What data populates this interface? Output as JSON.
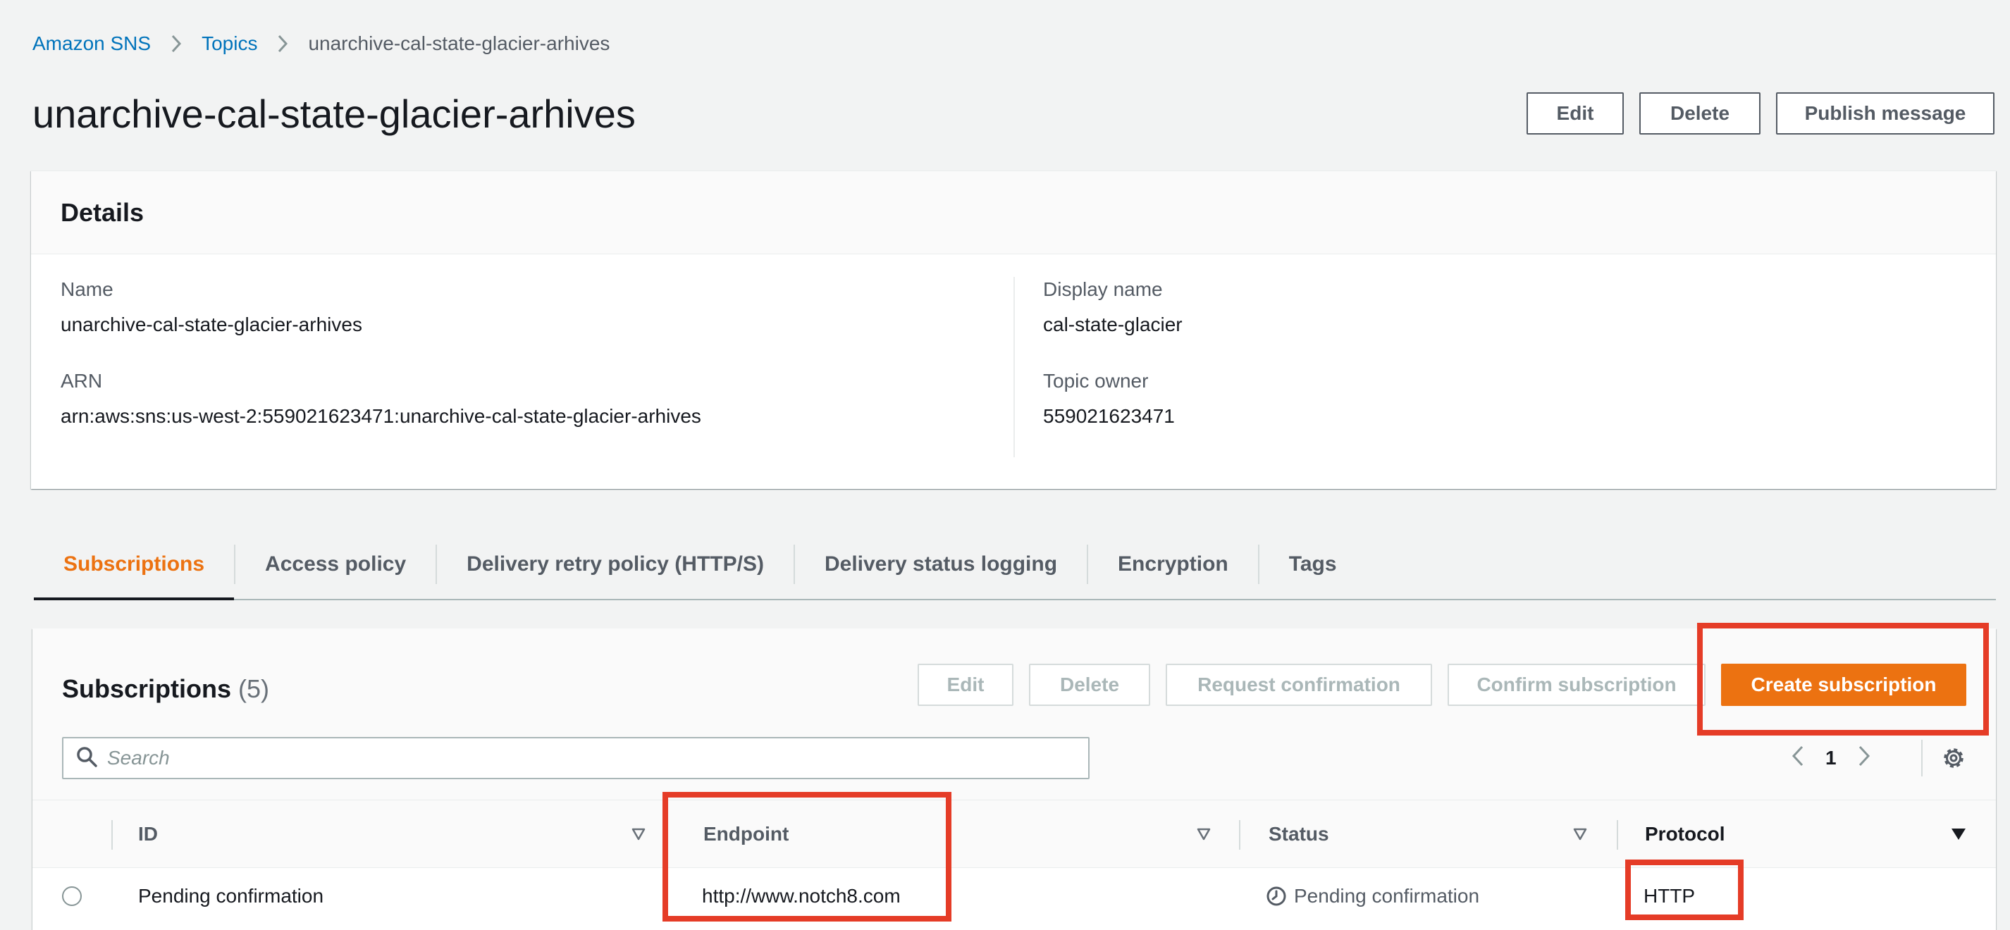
{
  "breadcrumb": {
    "root": "Amazon SNS",
    "topics": "Topics",
    "current": "unarchive-cal-state-glacier-arhives"
  },
  "page": {
    "title": "unarchive-cal-state-glacier-arhives"
  },
  "header_actions": {
    "edit": "Edit",
    "delete": "Delete",
    "publish": "Publish message"
  },
  "details": {
    "title": "Details",
    "name_label": "Name",
    "name_value": "unarchive-cal-state-glacier-arhives",
    "arn_label": "ARN",
    "arn_value": "arn:aws:sns:us-west-2:559021623471:unarchive-cal-state-glacier-arhives",
    "display_name_label": "Display name",
    "display_name_value": "cal-state-glacier",
    "owner_label": "Topic owner",
    "owner_value": "559021623471"
  },
  "tabs": [
    {
      "label": "Subscriptions",
      "active": true
    },
    {
      "label": "Access policy"
    },
    {
      "label": "Delivery retry policy (HTTP/S)"
    },
    {
      "label": "Delivery status logging"
    },
    {
      "label": "Encryption"
    },
    {
      "label": "Tags"
    }
  ],
  "subscriptions": {
    "title": "Subscriptions",
    "count": "(5)",
    "actions": {
      "edit": "Edit",
      "delete": "Delete",
      "request": "Request confirmation",
      "confirm": "Confirm subscription",
      "create": "Create subscription"
    },
    "search_placeholder": "Search",
    "page": "1",
    "columns": {
      "id": "ID",
      "endpoint": "Endpoint",
      "status": "Status",
      "protocol": "Protocol"
    },
    "rows": [
      {
        "id": "Pending confirmation",
        "endpoint": "http://www.notch8.com",
        "status": "Pending confirmation",
        "protocol": "HTTP"
      }
    ]
  },
  "colors": {
    "accent": "#ec7211",
    "link": "#0073bb",
    "highlight": "#e53c27"
  },
  "icons": [
    "chevron-right-icon",
    "search-icon",
    "chevron-left-icon",
    "gear-icon",
    "sort-icon",
    "clock-icon"
  ]
}
